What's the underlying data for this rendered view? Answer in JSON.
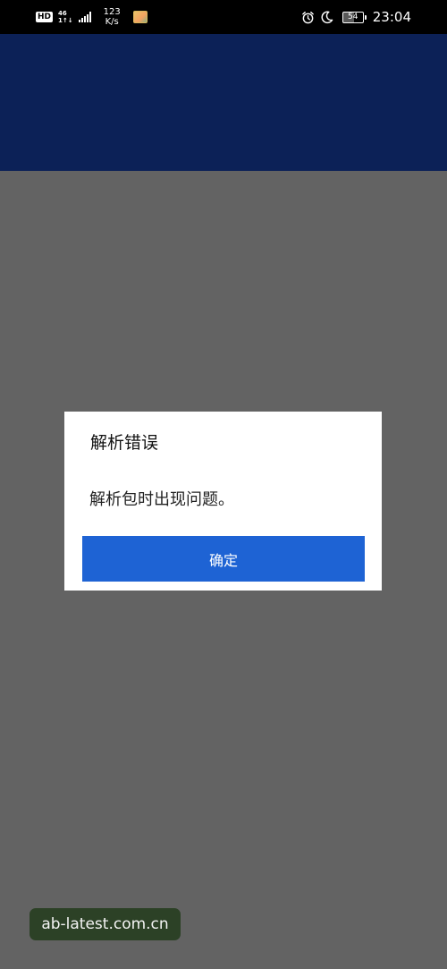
{
  "status_bar": {
    "hd_label": "HD",
    "network_type": "46",
    "network_sub": "1↑↓",
    "net_speed_value": "123",
    "net_speed_unit": "K/s",
    "battery_level": "54",
    "time": "23:04",
    "icons": [
      "hd-icon",
      "signal-icon",
      "photo-notification-icon",
      "alarm-icon",
      "do-not-disturb-icon",
      "battery-icon"
    ]
  },
  "colors": {
    "header_bg": "#0c2157",
    "scrim_bg": "#636363",
    "dialog_bg": "#ffffff",
    "button_bg": "#1e63d4",
    "watermark_bg": "#2c4126"
  },
  "dialog": {
    "title": "解析错误",
    "message": "解析包时出现问题。",
    "confirm_label": "确定"
  },
  "watermark": {
    "text": "ab-latest.com.cn"
  }
}
